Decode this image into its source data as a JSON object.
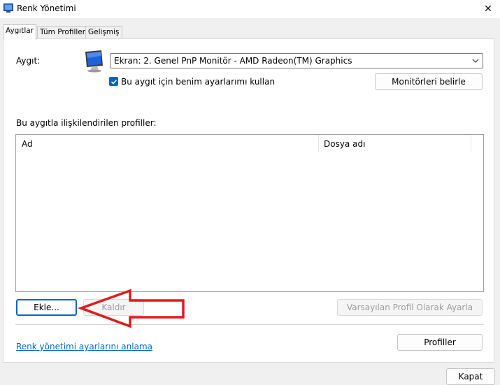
{
  "window": {
    "title": "Renk Yönetimi",
    "close_glyph": "✕"
  },
  "tabs": [
    {
      "label": "Aygıtlar",
      "active": true
    },
    {
      "label": "Tüm Profiller",
      "active": false
    },
    {
      "label": "Gelişmiş",
      "active": false
    }
  ],
  "device": {
    "label": "Aygıt:",
    "selected": "Ekran: 2. Genel PnP Monitör - AMD Radeon(TM) Graphics",
    "use_my_settings_label": "Bu aygıt için benim ayarlarımı kullan",
    "use_my_settings_checked": true,
    "identify_button": "Monitörleri belirle"
  },
  "profiles": {
    "section_label": "Bu aygıtla ilişkilendirilen profiller:",
    "columns": [
      "Ad",
      "Dosya adı"
    ],
    "rows": []
  },
  "buttons": {
    "add": "Ekle...",
    "remove": "Kaldır",
    "set_default": "Varsayılan Profil Olarak Ayarla",
    "profiles": "Profiller",
    "close": "Kapat"
  },
  "footer": {
    "help_link": "Renk yönetimi ayarlarını anlama"
  },
  "colors": {
    "accent": "#0067c0",
    "link": "#0066cc",
    "annotation_arrow": "#e01b1b"
  },
  "icons": {
    "title": "color-management-icon",
    "device": "monitor-icon",
    "combo": "chevron-down-icon",
    "checkbox": "checkmark-icon",
    "annotation": "red-arrow-annotation"
  }
}
